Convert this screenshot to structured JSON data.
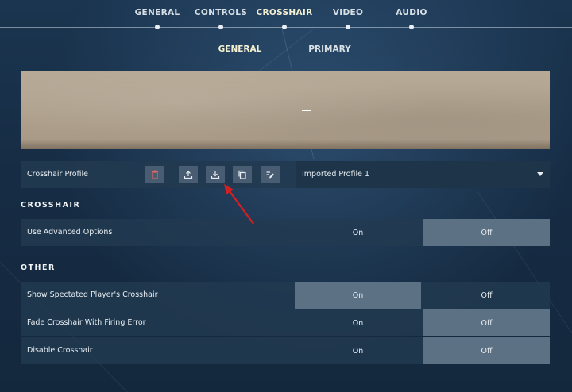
{
  "nav": {
    "tabs": [
      "GENERAL",
      "CONTROLS",
      "CROSSHAIR",
      "VIDEO",
      "AUDIO"
    ],
    "active_tab": "CROSSHAIR",
    "subtabs": [
      "GENERAL",
      "PRIMARY"
    ],
    "active_subtab": "GENERAL"
  },
  "profile": {
    "label": "Crosshair Profile",
    "selected": "Imported Profile 1",
    "icons": [
      "trash-icon",
      "upload-icon",
      "download-icon",
      "copy-icon",
      "edit-icon"
    ]
  },
  "sections": {
    "crosshair": "CROSSHAIR",
    "other": "OTHER"
  },
  "settings": [
    {
      "label": "Use Advanced Options",
      "on": "On",
      "off": "Off",
      "value": "Off"
    },
    {
      "label": "Show Spectated Player's Crosshair",
      "on": "On",
      "off": "Off",
      "value": "On"
    },
    {
      "label": "Fade Crosshair With Firing Error",
      "on": "On",
      "off": "Off",
      "value": "Off"
    },
    {
      "label": "Disable Crosshair",
      "on": "On",
      "off": "Off",
      "value": "Off"
    }
  ],
  "colors": {
    "annotation_arrow": "#d42020",
    "active_tab": "#f3f0d2"
  }
}
